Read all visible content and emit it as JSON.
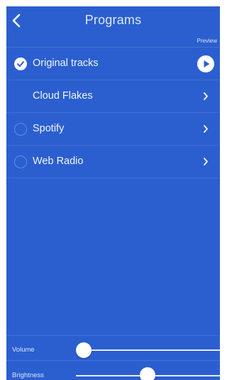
{
  "header": {
    "title": "Programs",
    "back_icon": "chevron-left-icon"
  },
  "preview_label": "Preview",
  "programs": [
    {
      "label": "Original tracks",
      "selected": true,
      "trailing": "play-icon"
    },
    {
      "label": "Cloud Flakes",
      "selected": null,
      "trailing": "chevron-right-icon"
    },
    {
      "label": "Spotify",
      "selected": false,
      "trailing": "chevron-right-icon"
    },
    {
      "label": "Web Radio",
      "selected": false,
      "trailing": "chevron-right-icon"
    }
  ],
  "controls": {
    "volume": {
      "label": "Volume",
      "value": 0.0
    },
    "brightness": {
      "label": "Brightness",
      "value": 0.5
    }
  },
  "colors": {
    "background": "#2b5fcf",
    "text": "#ffffff"
  }
}
